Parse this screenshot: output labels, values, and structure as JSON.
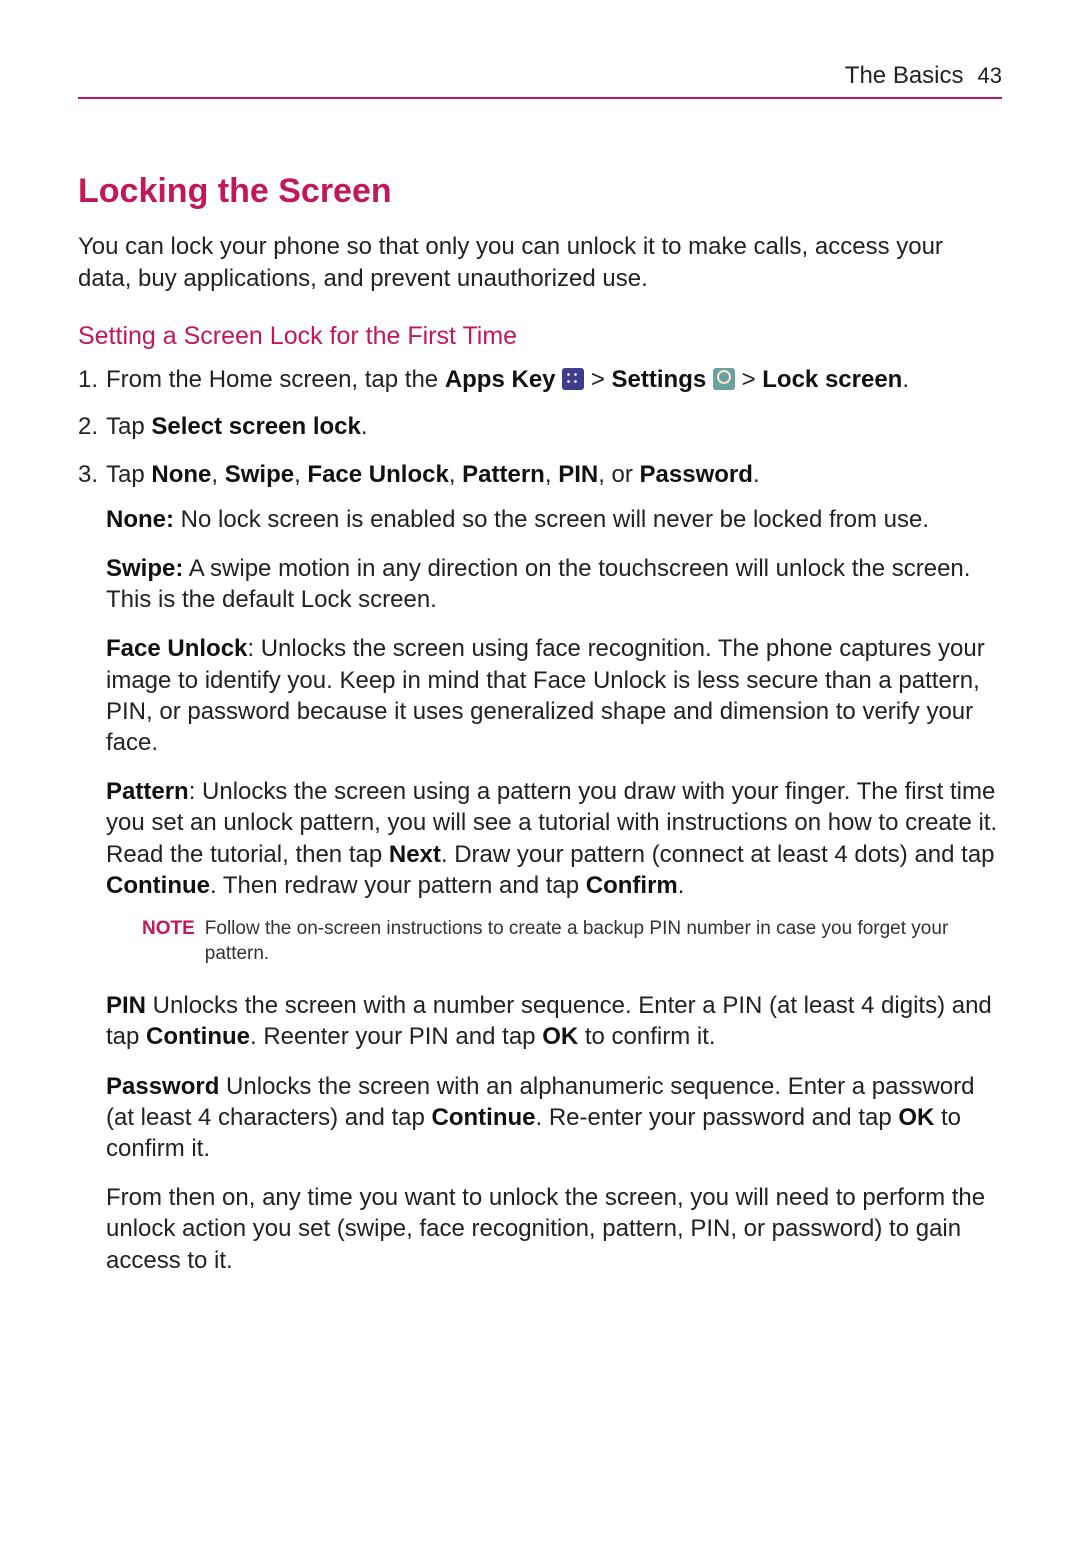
{
  "header": {
    "section": "The Basics",
    "page": "43"
  },
  "title": "Locking the Screen",
  "intro": "You can lock your phone so that only you can unlock it to make calls, access your data, buy applications, and prevent unauthorized use.",
  "sub_heading": "Setting a Screen Lock for the First Time",
  "step1": {
    "pre": "From the Home screen, tap the ",
    "apps_key": "Apps Key",
    "gt1": " > ",
    "settings": "Settings",
    "gt2": " > ",
    "lock_screen": "Lock screen",
    "end": "."
  },
  "step2": {
    "pre": "Tap ",
    "bold": "Select screen lock",
    "end": "."
  },
  "step3": {
    "pre": "Tap ",
    "none": "None",
    "c1": ", ",
    "swipe": "Swipe",
    "c2": ", ",
    "face": "Face Unlock",
    "c3": ", ",
    "pattern": "Pattern",
    "c4": ", ",
    "pin": "PIN",
    "c5": ", or ",
    "password": "Password",
    "end": "."
  },
  "desc_none": {
    "label": "None:",
    "text": " No lock screen is enabled so the screen will never be locked from use."
  },
  "desc_swipe": {
    "label": "Swipe:",
    "text": " A swipe motion in any direction on the touchscreen will unlock the screen. This is the default Lock screen."
  },
  "desc_face": {
    "label": "Face Unlock",
    "text": ": Unlocks the screen using face recognition. The phone captures your image to identify you. Keep in mind that Face Unlock is less secure than a pattern, PIN, or password because it uses generalized shape and dimension to verify your face."
  },
  "desc_pattern": {
    "label": "Pattern",
    "t1": ": Unlocks the screen using a pattern you draw with your finger. The first time you set an unlock pattern, you will see a tutorial with instructions on how to create it. Read the tutorial, then tap ",
    "next": "Next",
    "t2": ". Draw your pattern (connect at least 4 dots) and tap ",
    "cont": "Continue",
    "t3": ". Then redraw your pattern and tap ",
    "confirm": "Confirm",
    "t4": "."
  },
  "note": {
    "label": "NOTE",
    "text": "Follow the on-screen instructions to create a backup PIN number in case you forget your pattern."
  },
  "desc_pin": {
    "label": "PIN",
    "t1": " Unlocks the screen with a number sequence. Enter a PIN (at least 4 digits) and tap ",
    "cont": "Continue",
    "t2": ". Reenter your PIN and tap ",
    "ok": "OK",
    "t3": " to confirm it."
  },
  "desc_password": {
    "label": "Password",
    "t1": " Unlocks the screen with an alphanumeric sequence. Enter a password (at least 4 characters) and tap ",
    "cont": "Continue",
    "t2": ". Re-enter your password and tap ",
    "ok": "OK",
    "t3": " to confirm it."
  },
  "outro": "From then on, any time you want to unlock the screen, you will need to perform the unlock action you set (swipe, face recognition, pattern, PIN, or password) to gain access to it."
}
